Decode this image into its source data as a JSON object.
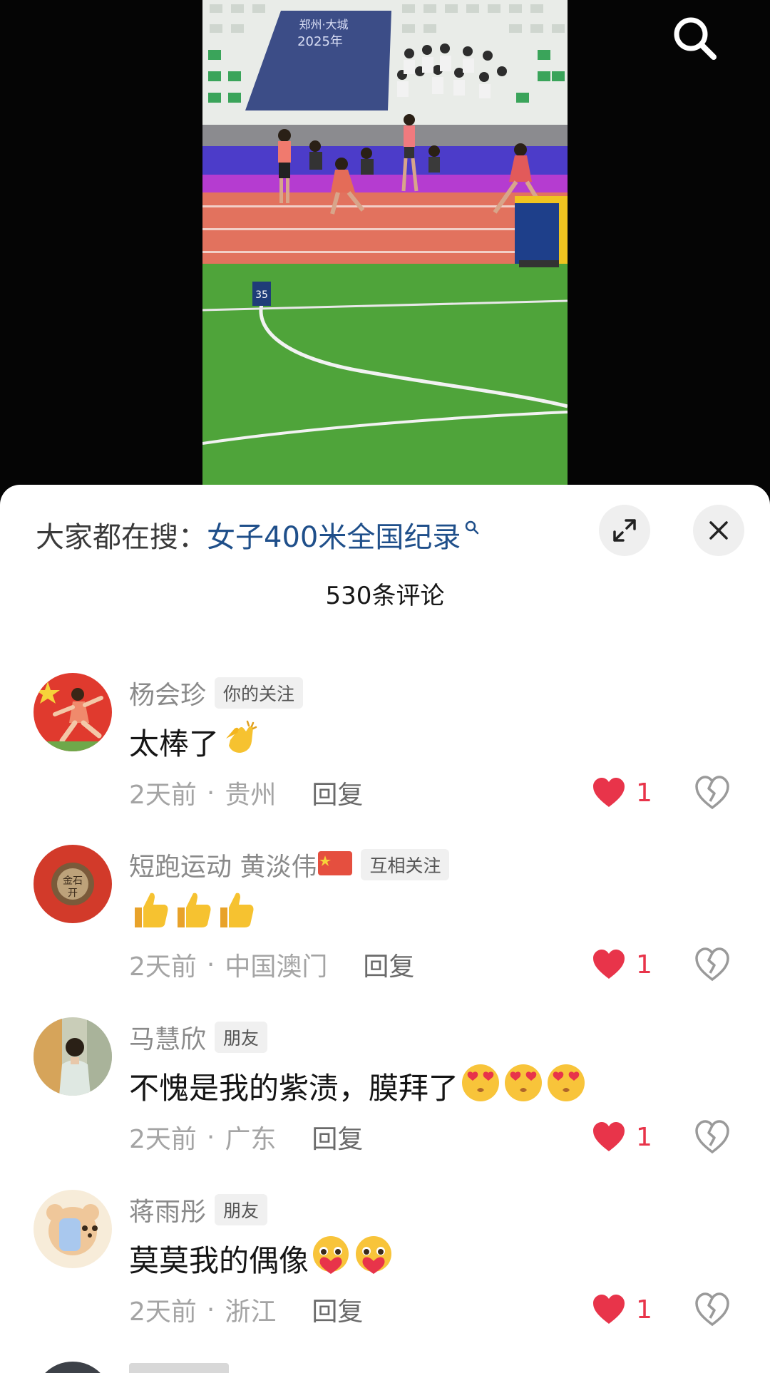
{
  "header": {
    "search_icon": "search-icon"
  },
  "video": {
    "stadium_banner_line1": "郑州·大城",
    "stadium_banner_line2": "2025年",
    "lane_marker": "35"
  },
  "sheet": {
    "trending_prefix": "大家都在搜：",
    "trending_term": "女子400米全国纪录",
    "comment_count": "530条评论",
    "expand_icon": "expand-icon",
    "close_icon": "close-icon"
  },
  "comments": [
    {
      "user": "杨会珍",
      "badge": "你的关注",
      "text": "太棒了",
      "emoji": "clap",
      "time": "2天前",
      "location": "贵州",
      "reply": "回复",
      "likes": "1"
    },
    {
      "user": "短跑运动 黄淡伟",
      "badge": "互相关注",
      "text": "",
      "emoji": "thumbs-up-x3",
      "time": "2天前",
      "location": "中国澳门",
      "reply": "回复",
      "likes": "1"
    },
    {
      "user": "马慧欣",
      "badge": "朋友",
      "text": "不愧是我的紫渍，膜拜了",
      "emoji": "heart-eyes-x3",
      "time": "2天前",
      "location": "广东",
      "reply": "回复",
      "likes": "1"
    },
    {
      "user": "蒋雨彤",
      "badge": "朋友",
      "text": "莫莫我的偶像",
      "emoji": "pleading-heart-x2",
      "time": "2天前",
      "location": "浙江",
      "reply": "回复",
      "likes": "1"
    }
  ],
  "colors": {
    "like_red": "#e8344a",
    "trending_blue": "#1f4f8a",
    "username_gray": "#8a8a8a"
  }
}
